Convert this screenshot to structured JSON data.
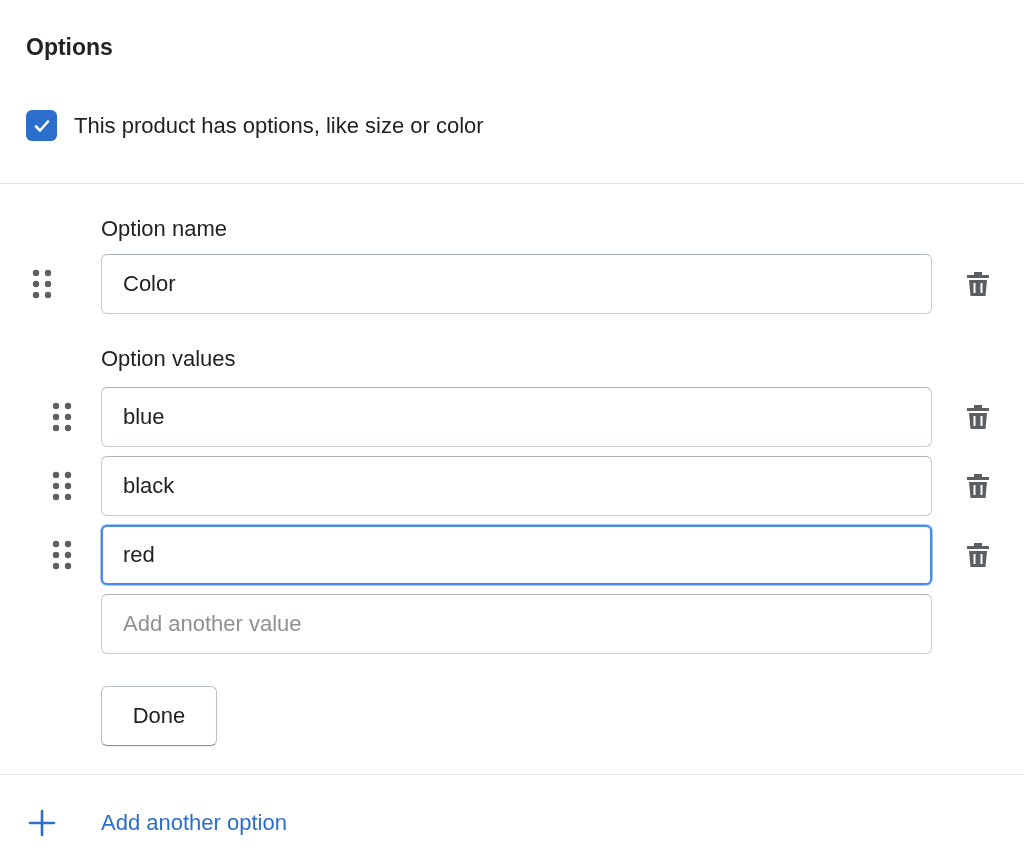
{
  "title": "Options",
  "has_options": {
    "label": "This product has options, like size or color",
    "checked": true
  },
  "option": {
    "name_label": "Option name",
    "name_value": "Color",
    "values_label": "Option values",
    "values": [
      {
        "value": "blue",
        "focused": false
      },
      {
        "value": "black",
        "focused": false
      },
      {
        "value": "red",
        "focused": true
      }
    ],
    "new_value_placeholder": "Add another value",
    "done_button": "Done"
  },
  "add_option": "Add another option"
}
